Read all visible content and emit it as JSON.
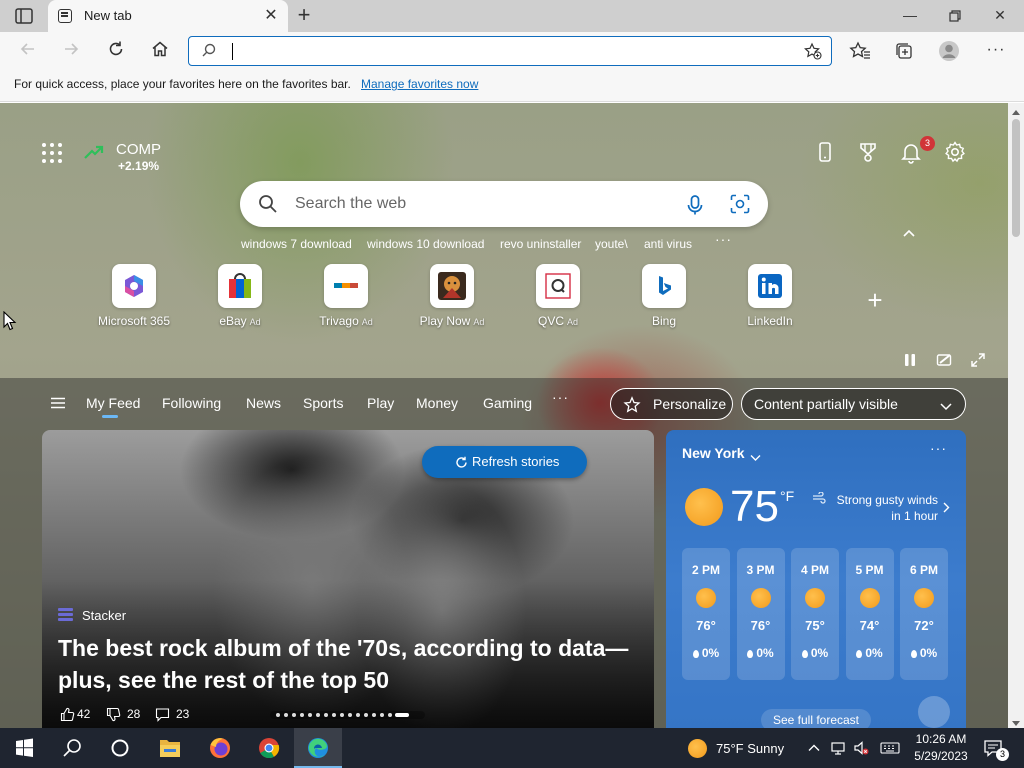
{
  "browser": {
    "tab_title": "New tab",
    "address_value": "",
    "favorites_bar_text": "For quick access, place your favorites here on the favorites bar.",
    "favorites_bar_link": "Manage favorites now"
  },
  "stock": {
    "symbol": "COMP",
    "change": "+2.19%"
  },
  "notifications": {
    "count": "3"
  },
  "search": {
    "placeholder": "Search the web",
    "trending": [
      "windows 7 download",
      "windows 10 download",
      "revo uninstaller",
      "youte\\",
      "anti virus"
    ],
    "more": "···"
  },
  "quick_links": [
    {
      "label": "Microsoft 365",
      "ad": ""
    },
    {
      "label": "eBay",
      "ad": "Ad"
    },
    {
      "label": "Trivago",
      "ad": "Ad"
    },
    {
      "label": "Play Now",
      "ad": "Ad"
    },
    {
      "label": "QVC",
      "ad": "Ad"
    },
    {
      "label": "Bing",
      "ad": ""
    },
    {
      "label": "LinkedIn",
      "ad": ""
    }
  ],
  "feed": {
    "tabs": [
      "My Feed",
      "Following",
      "News",
      "Sports",
      "Play",
      "Money",
      "Gaming"
    ],
    "more": "···",
    "personalize": "Personalize",
    "visibility": "Content partially visible"
  },
  "hero": {
    "refresh_label": "Refresh stories",
    "source": "Stacker",
    "headline": "The best rock album of the '70s, according to data—plus, see the rest of the top 50",
    "likes": "42",
    "dislikes": "28",
    "comments": "23",
    "carousel": {
      "count": 16,
      "active": 15
    }
  },
  "weather": {
    "city": "New York",
    "temp": "75",
    "unit": "°F",
    "wind_alert": "Strong gusty winds in 1 hour",
    "hourly": [
      {
        "time": "2 PM",
        "temp": "76°",
        "precip": "0%"
      },
      {
        "time": "3 PM",
        "temp": "76°",
        "precip": "0%"
      },
      {
        "time": "4 PM",
        "temp": "75°",
        "precip": "0%"
      },
      {
        "time": "5 PM",
        "temp": "74°",
        "precip": "0%"
      },
      {
        "time": "6 PM",
        "temp": "72°",
        "precip": "0%"
      }
    ],
    "full_forecast": "See full forecast"
  },
  "taskbar": {
    "weather": "75°F  Sunny",
    "time": "10:26 AM",
    "date": "5/29/2023",
    "notifications": "3"
  },
  "colors": {
    "accent": "#0f6cbd",
    "weather_bg": "#3575c6",
    "taskbar_bg": "#1f2530",
    "notif_badge": "#d13438"
  }
}
